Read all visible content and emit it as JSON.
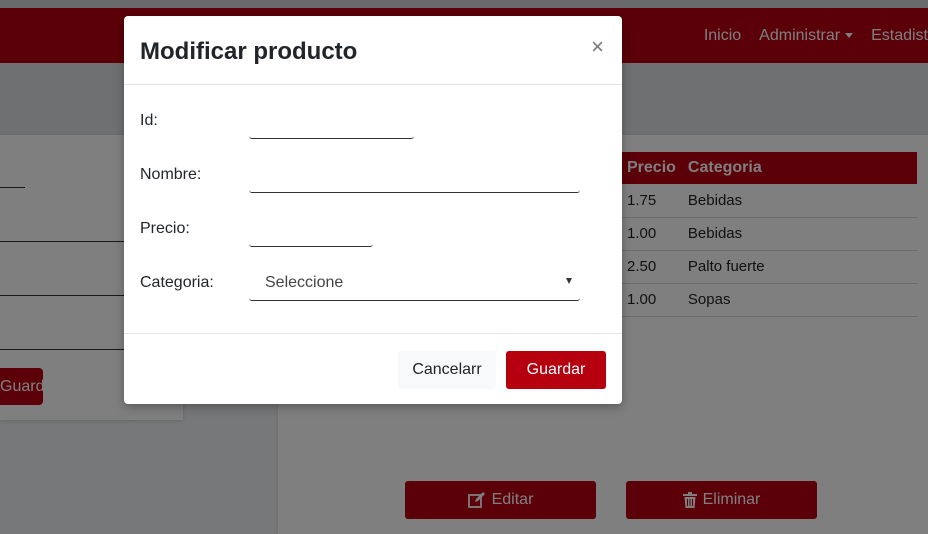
{
  "navbar": {
    "links": [
      {
        "label": "Inicio"
      },
      {
        "label": "Administrar",
        "has_caret": true
      },
      {
        "label": "Estadist"
      }
    ]
  },
  "left_form": {
    "button_label": "Guardar"
  },
  "products_table": {
    "headers": [
      "",
      "Precio",
      "Categoria"
    ],
    "rows": [
      {
        "precio": "1.75",
        "categoria": "Bebidas"
      },
      {
        "precio": "1.00",
        "categoria": "Bebidas"
      },
      {
        "precio": "2.50",
        "categoria": "Palto fuerte"
      },
      {
        "precio": "1.00",
        "categoria": "Sopas"
      }
    ]
  },
  "actions": {
    "edit_label": "Editar",
    "edit_icon": "edit-icon",
    "delete_label": "Eliminar",
    "delete_icon": "trash-icon"
  },
  "modal": {
    "title": "Modificar producto",
    "close_symbol": "×",
    "fields": {
      "id": {
        "label": "Id:",
        "value": ""
      },
      "nombre": {
        "label": "Nombre:",
        "value": ""
      },
      "precio": {
        "label": "Precio:",
        "value": ""
      },
      "categoria": {
        "label": "Categoria:",
        "selected": "Seleccione"
      }
    },
    "cancel_label": "Cancelarr",
    "save_label": "Guardar"
  },
  "colors": {
    "brand": "#b60010",
    "overlay": "rgba(0,0,0,0.5)"
  }
}
